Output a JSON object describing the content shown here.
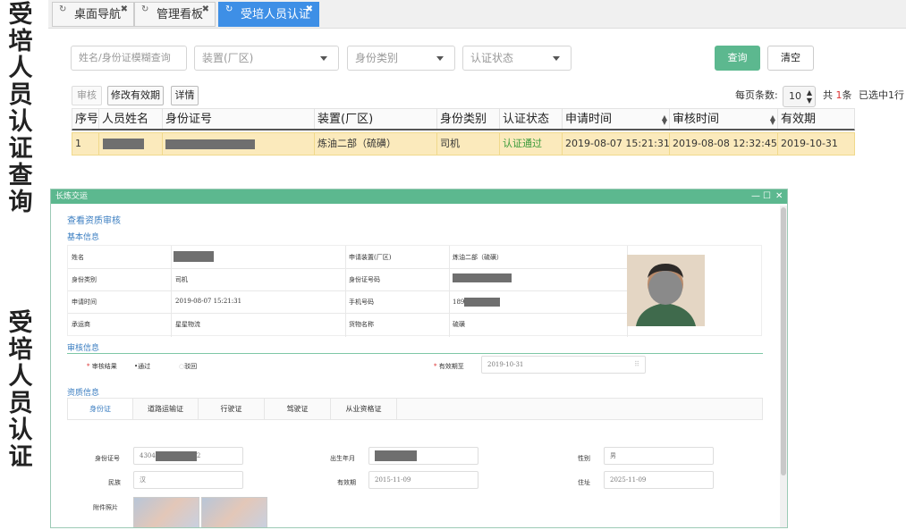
{
  "side_titles": {
    "top": "受培人员认证查询",
    "bottom": "受培人员认证"
  },
  "tabs": [
    {
      "label": "桌面导航",
      "active": false
    },
    {
      "label": "管理看板",
      "active": false
    },
    {
      "label": "受培人员认证",
      "active": true
    }
  ],
  "filters": {
    "search_placeholder": "姓名/身份证模糊查询",
    "device_placeholder": "装置(厂区)",
    "identity_placeholder": "身份类别",
    "status_placeholder": "认证状态",
    "query_label": "查询",
    "clear_label": "清空"
  },
  "toolbar": {
    "audit": "审核",
    "modify": "修改有效期",
    "detail": "详情"
  },
  "pager": {
    "per_page_label": "每页条数:",
    "per_page": "10",
    "total_prefix": "共",
    "total": "1",
    "total_suffix": "条",
    "selected": "已选中1行"
  },
  "table": {
    "headers": [
      "序号",
      "人员姓名",
      "身份证号",
      "装置(厂区)",
      "身份类别",
      "认证状态",
      "申请时间",
      "审核时间",
      "有效期"
    ],
    "row": {
      "index": "1",
      "device": "炼油二部（硫磺）",
      "identity": "司机",
      "status": "认证通过",
      "apply_time": "2019-08-07 15:21:31",
      "audit_time": "2019-08-08 12:32:45",
      "valid": "2019-10-31"
    }
  },
  "dialog": {
    "title": "长炼交运",
    "heading": "查看资质审核",
    "basic_title": "基本信息",
    "basic": {
      "name_label": "姓名",
      "apply_device_label": "申请装置(厂区)",
      "apply_device": "炼油二部（硫磺）",
      "identity_label": "身份类别",
      "identity": "司机",
      "idno_label": "身份证号码",
      "apply_time_label": "申请时间",
      "apply_time": "2019-08-07 15:21:31",
      "phone_label": "手机号码",
      "phone_prefix": "189",
      "carrier_label": "承运商",
      "carrier": "星星物流",
      "goods_label": "货物名称",
      "goods": "硫磺"
    },
    "audit_title": "审核信息",
    "audit": {
      "result_label": "审核结果",
      "pass": "通过",
      "reject": "驳回",
      "valid_label": "有效期至",
      "valid_value": "2019-10-31"
    },
    "qual_title": "资质信息",
    "subtabs": [
      "身份证",
      "道路运输证",
      "行驶证",
      "驾驶证",
      "从业资格证"
    ],
    "id_card": {
      "idno_label": "身份证号",
      "idno_prefix": "4304",
      "idno_suffix": "2",
      "birth_label": "出生年月",
      "gender_label": "性别",
      "gender": "男",
      "nation_label": "民族",
      "nation": "汉",
      "valid_label": "有效期",
      "valid_value": "2015-11-09",
      "address_label": "住址",
      "address_value": "2025-11-09",
      "attach_label": "附件照片"
    }
  },
  "colors": {
    "accent": "#3e8fe6",
    "primary_green": "#5cb88f",
    "row_highlight": "#fbeabc",
    "section_blue": "#3b7ec1"
  }
}
